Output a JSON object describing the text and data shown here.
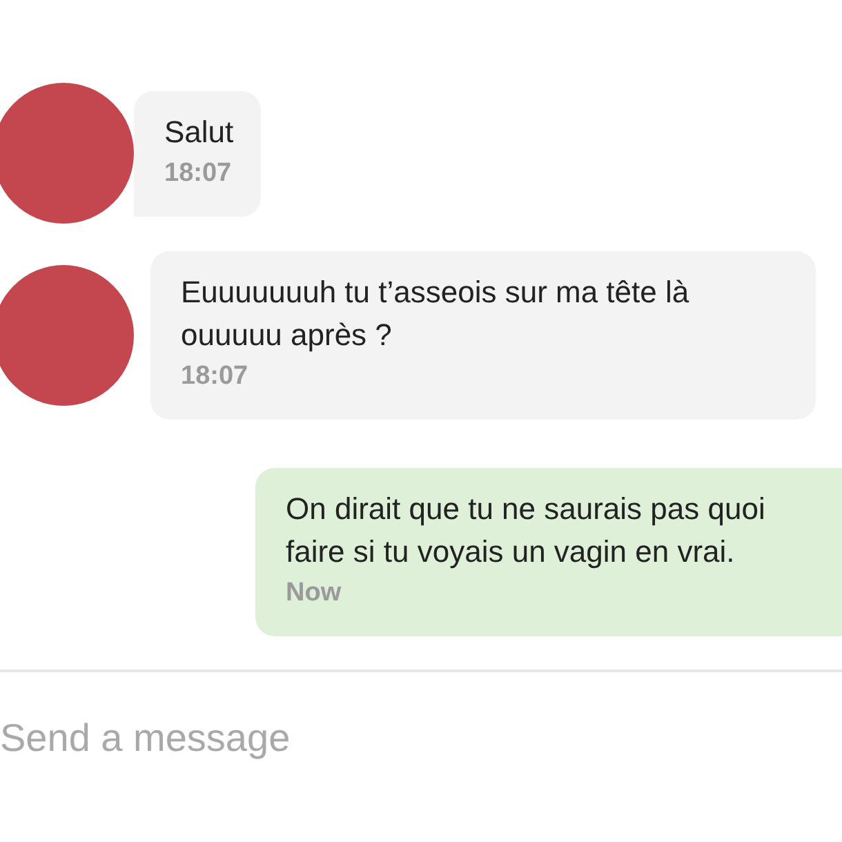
{
  "messages": [
    {
      "kind": "received",
      "text": "Salut",
      "time": "18:07"
    },
    {
      "kind": "received",
      "text": "Euuuuuuuh tu t’asseois sur ma tête là ouuuuu après ?",
      "time": "18:07"
    },
    {
      "kind": "sent",
      "text": "On dirait que tu ne saurais pas quoi faire si tu voyais un vagin en vrai.",
      "time": "Now"
    }
  ],
  "composer": {
    "placeholder": "Send a message"
  }
}
